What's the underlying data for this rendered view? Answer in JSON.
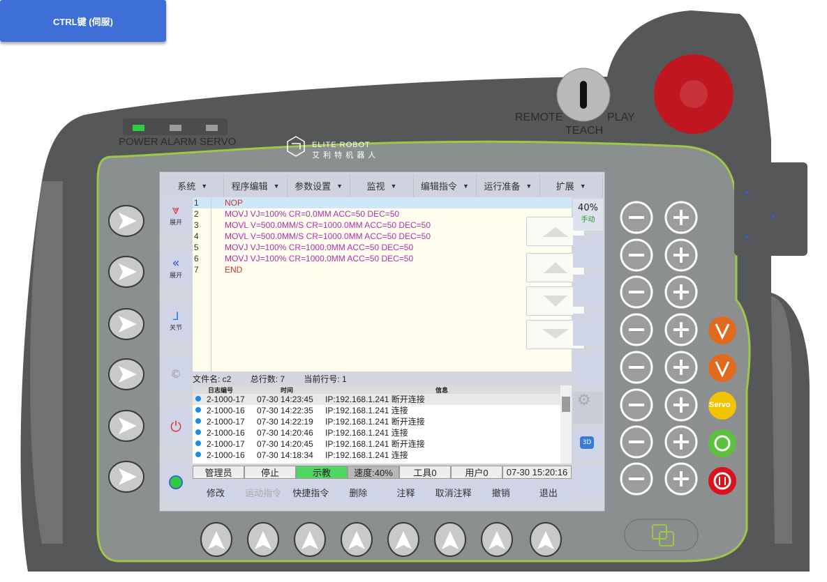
{
  "ctrl_button": "CTRL键 (伺服)",
  "leds": {
    "power": "POWER",
    "alarm": "ALARM",
    "servo": "SERVO"
  },
  "key_switch": {
    "remote": "REMOTE",
    "teach": "TEACH",
    "play": "PLAY"
  },
  "logo": {
    "line1": "ELITE ROBOT",
    "line2": "艾 利 特 机 器 人"
  },
  "menu": [
    "系统",
    "程序编辑",
    "参数设置",
    "监视",
    "编辑指令",
    "运行准备",
    "扩展"
  ],
  "left_side": [
    "展开",
    "展开",
    "关节",
    "",
    "",
    ""
  ],
  "program": [
    {
      "n": "1",
      "code": "NOP"
    },
    {
      "n": "2",
      "code": "MOVJ VJ=100% CR=0.0MM ACC=50 DEC=50"
    },
    {
      "n": "3",
      "code": "MOVL V=500.0MM/S CR=1000.0MM ACC=50 DEC=50"
    },
    {
      "n": "4",
      "code": "MOVL V=500.0MM/S CR=1000.0MM ACC=50 DEC=50"
    },
    {
      "n": "5",
      "code": "MOVJ VJ=100% CR=1000.0MM ACC=50 DEC=50"
    },
    {
      "n": "6",
      "code": "MOVJ VJ=100% CR=1000.0MM ACC=50 DEC=50"
    },
    {
      "n": "7",
      "code": "END"
    }
  ],
  "speed": {
    "value": "40%",
    "mode": "手动"
  },
  "file_info": {
    "name": "文件名: c2",
    "lines": "总行数: 7",
    "current": "当前行号: 1"
  },
  "log_headers": [
    "日志编号",
    "时间",
    "信息"
  ],
  "log_rows": [
    {
      "id": "2-1000-17",
      "time": "07-30 14:23:45",
      "msg": "IP:192.168.1.241 断开连接"
    },
    {
      "id": "2-1000-16",
      "time": "07-30 14:22:35",
      "msg": "IP:192.168.1.241 连接"
    },
    {
      "id": "2-1000-17",
      "time": "07-30 14:22:19",
      "msg": "IP:192.168.1.241 断开连接"
    },
    {
      "id": "2-1000-16",
      "time": "07-30 14:20:46",
      "msg": "IP:192.168.1.241 连接"
    },
    {
      "id": "2-1000-17",
      "time": "07-30 14:20:45",
      "msg": "IP:192.168.1.241 断开连接"
    },
    {
      "id": "2-1000-16",
      "time": "07-30 14:18:34",
      "msg": "IP:192.168.1.241 连接"
    }
  ],
  "status": {
    "user": "管理员",
    "state": "停止",
    "mode": "示教",
    "speed": "速度:40%",
    "tool": "工具0",
    "userframe": "用户0",
    "time": "07-30 15:20:16"
  },
  "bottom_buttons": [
    "修改",
    "运动指令",
    "快捷指令",
    "删除",
    "注释",
    "取消注释",
    "撤销",
    "退出"
  ],
  "servo_label": "Servo",
  "colors": {
    "body": "#555758",
    "panel": "#8c8f90",
    "accent": "#9cc84a",
    "estop": "#c0161f",
    "blue_btn": "#3d6fd6"
  }
}
